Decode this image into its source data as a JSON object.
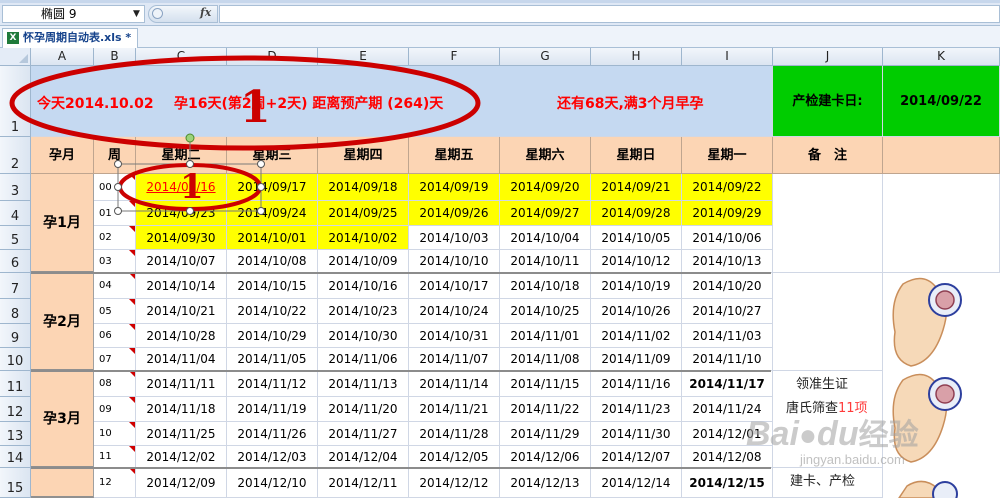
{
  "namebox": {
    "value": "椭圆 9"
  },
  "tab": {
    "filename": "怀孕周期自动表.xls *"
  },
  "columns": [
    "A",
    "B",
    "C",
    "D",
    "E",
    "F",
    "G",
    "H",
    "I",
    "J",
    "K"
  ],
  "rows": [
    "1",
    "2",
    "3",
    "4",
    "5",
    "6",
    "7",
    "8",
    "9",
    "10",
    "11",
    "12",
    "13",
    "14",
    "15"
  ],
  "banner": {
    "today": "今天2014.10.02",
    "pregnancy": "孕16天(第2周+2天) 距离预产期 (264)天",
    "remaining": "还有68天,满3个月早孕",
    "checkup_label": "产检建卡日:",
    "checkup_date": "2014/09/22",
    "callout_number": "1"
  },
  "headers": [
    "孕月",
    "周",
    "星期二",
    "星期三",
    "星期四",
    "星期五",
    "星期六",
    "星期日",
    "星期一",
    "备　注"
  ],
  "months": [
    "孕1月",
    "孕2月",
    "孕3月"
  ],
  "weeks": [
    "00",
    "01",
    "02",
    "03",
    "04",
    "05",
    "06",
    "07",
    "08",
    "09",
    "10",
    "11",
    "12"
  ],
  "dates": [
    [
      "2014/09/16",
      "2014/09/17",
      "2014/09/18",
      "2014/09/19",
      "2014/09/20",
      "2014/09/21",
      "2014/09/22"
    ],
    [
      "2014/09/23",
      "2014/09/24",
      "2014/09/25",
      "2014/09/26",
      "2014/09/27",
      "2014/09/28",
      "2014/09/29"
    ],
    [
      "2014/09/30",
      "2014/10/01",
      "2014/10/02",
      "2014/10/03",
      "2014/10/04",
      "2014/10/05",
      "2014/10/06"
    ],
    [
      "2014/10/07",
      "2014/10/08",
      "2014/10/09",
      "2014/10/10",
      "2014/10/11",
      "2014/10/12",
      "2014/10/13"
    ],
    [
      "2014/10/14",
      "2014/10/15",
      "2014/10/16",
      "2014/10/17",
      "2014/10/18",
      "2014/10/19",
      "2014/10/20"
    ],
    [
      "2014/10/21",
      "2014/10/22",
      "2014/10/23",
      "2014/10/24",
      "2014/10/25",
      "2014/10/26",
      "2014/10/27"
    ],
    [
      "2014/10/28",
      "2014/10/29",
      "2014/10/30",
      "2014/10/31",
      "2014/11/01",
      "2014/11/02",
      "2014/11/03"
    ],
    [
      "2014/11/04",
      "2014/11/05",
      "2014/11/06",
      "2014/11/07",
      "2014/11/08",
      "2014/11/09",
      "2014/11/10"
    ],
    [
      "2014/11/11",
      "2014/11/12",
      "2014/11/13",
      "2014/11/14",
      "2014/11/15",
      "2014/11/16",
      "2014/11/17"
    ],
    [
      "2014/11/18",
      "2014/11/19",
      "2014/11/20",
      "2014/11/21",
      "2014/11/22",
      "2014/11/23",
      "2014/11/24"
    ],
    [
      "2014/11/25",
      "2014/11/26",
      "2014/11/27",
      "2014/11/28",
      "2014/11/29",
      "2014/11/30",
      "2014/12/01"
    ],
    [
      "2014/12/02",
      "2014/12/03",
      "2014/12/04",
      "2014/12/05",
      "2014/12/06",
      "2014/12/07",
      "2014/12/08"
    ],
    [
      "2014/12/09",
      "2014/12/10",
      "2014/12/11",
      "2014/12/12",
      "2014/12/13",
      "2014/12/14",
      "2014/12/15"
    ]
  ],
  "bold_cells": [
    "2014/11/17",
    "2014/12/15"
  ],
  "notes": {
    "r11": "领准生证",
    "r12a": "唐氏筛查",
    "r12b": "11项",
    "r15": "建卡、产检"
  },
  "watermark": {
    "brand": "Bai",
    "brand2": "du",
    "suffix": "经验",
    "url": "jingyan.baidu.com"
  },
  "colors": {
    "banner_bg": "#c5d9f1",
    "header_bg": "#fcd5b4",
    "highlight": "#ffff00",
    "checkup_bg": "#00cc00",
    "accent_red": "#ff0000"
  }
}
